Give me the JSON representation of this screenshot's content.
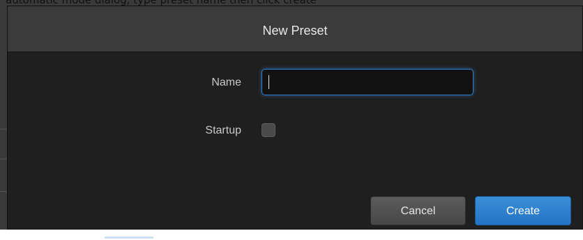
{
  "background_text": "automatic mode dialog, type preset name then click create",
  "dialog": {
    "title": "New Preset",
    "fields": {
      "name_label": "Name",
      "name_value": "",
      "startup_label": "Startup",
      "startup_checked": false
    },
    "buttons": {
      "cancel": "Cancel",
      "create": "Create"
    }
  },
  "colors": {
    "dialog_bg": "#1f1f1f",
    "header_bg": "#3b3b3b",
    "focus_ring": "#2f7fc9",
    "primary_button": "#2474c3",
    "secondary_button": "#474747"
  }
}
